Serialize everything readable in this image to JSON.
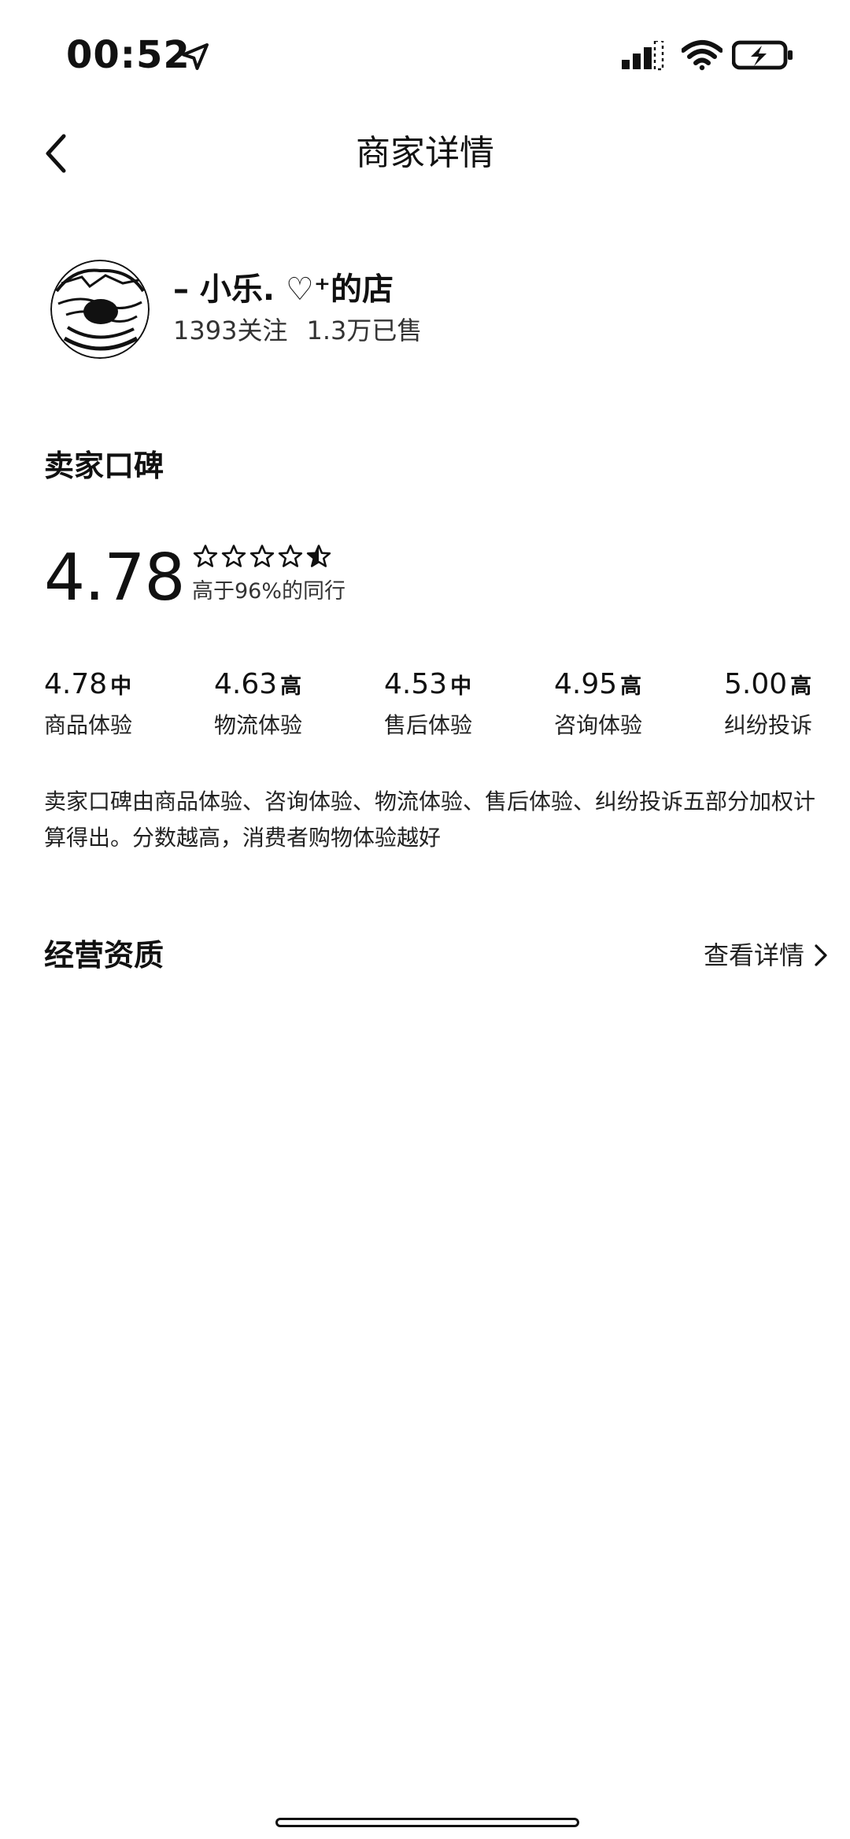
{
  "status_bar": {
    "time": "00:52",
    "icons": [
      "location-arrow-icon",
      "signal-icon",
      "wifi-icon",
      "battery-charging-icon"
    ]
  },
  "nav": {
    "back_icon": "chevron-left-icon",
    "title": "商家详情"
  },
  "shop": {
    "name": "– 小乐. ♡⁺的店",
    "followers": "1393关注",
    "sold": "1.3万已售"
  },
  "reputation": {
    "section_title": "卖家口碑",
    "score": "4.78",
    "stars": 4.78,
    "percentile_text": "高于96%的同行",
    "metrics": [
      {
        "value": "4.78",
        "level": "中",
        "label": "商品体验"
      },
      {
        "value": "4.63",
        "level": "高",
        "label": "物流体验"
      },
      {
        "value": "4.53",
        "level": "中",
        "label": "售后体验"
      },
      {
        "value": "4.95",
        "level": "高",
        "label": "咨询体验"
      },
      {
        "value": "5.00",
        "level": "高",
        "label": "纠纷投诉"
      }
    ],
    "description": "卖家口碑由商品体验、咨询体验、物流体验、售后体验、纠纷投诉五部分加权计算得出。分数越高，消费者购物体验越好"
  },
  "qualification": {
    "section_title": "经营资质",
    "link_label": "查看详情",
    "link_icon": "chevron-right-icon"
  }
}
